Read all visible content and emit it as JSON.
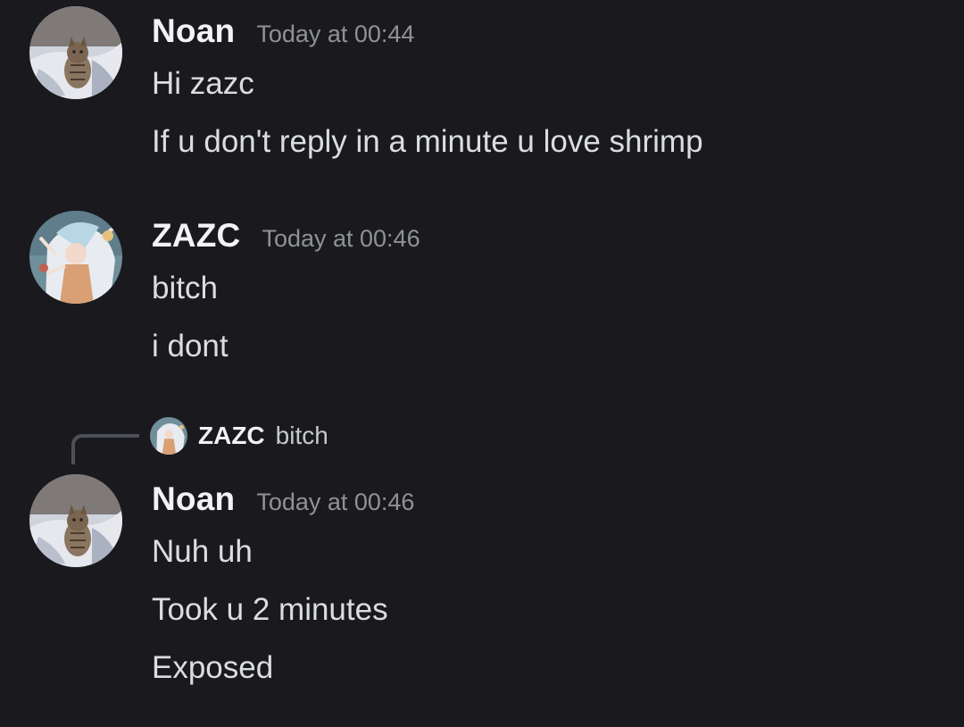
{
  "messages": [
    {
      "author": "Noan",
      "timestamp": "Today at 00:44",
      "avatar_icon": "cat-avatar-icon",
      "lines": [
        "Hi zazc",
        "If u don't reply in a minute u love shrimp"
      ]
    },
    {
      "author": "ZAZC",
      "timestamp": "Today at 00:46",
      "avatar_icon": "anime-avatar-icon",
      "lines": [
        "bitch",
        "i dont"
      ]
    },
    {
      "author": "Noan",
      "timestamp": "Today at 00:46",
      "avatar_icon": "cat-avatar-icon",
      "reply_to": {
        "author": "ZAZC",
        "text": "bitch"
      },
      "lines": [
        "Nuh uh",
        "Took u 2 minutes",
        "Exposed"
      ]
    }
  ],
  "colors": {
    "background": "#1a1a1e",
    "author": "#f2f3f5",
    "timestamp": "#8e9297",
    "text": "#dbdee1",
    "reply_spine": "#4e5058"
  }
}
